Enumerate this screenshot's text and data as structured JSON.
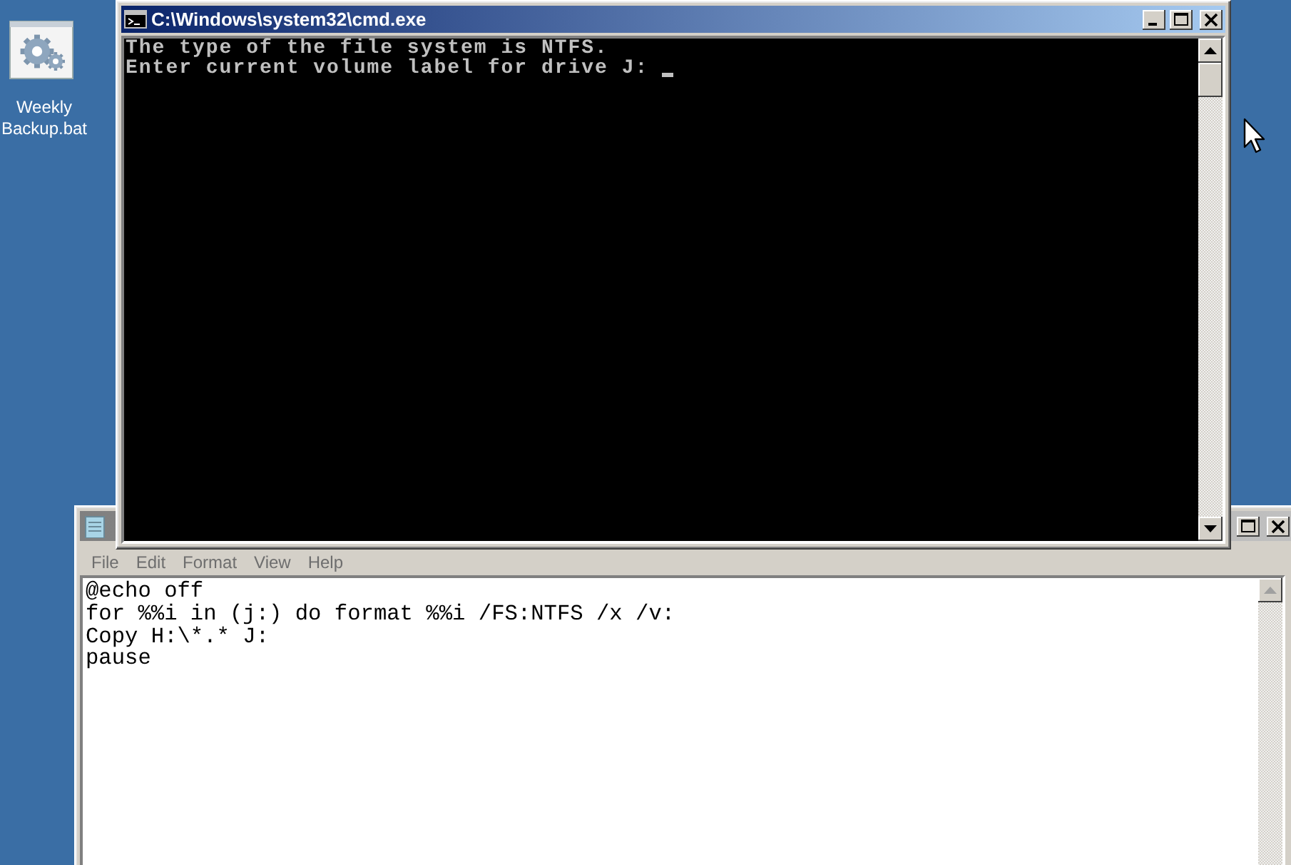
{
  "desktop_icons": [
    {
      "label": "Weekly Backup.bat"
    }
  ],
  "windows": [
    {
      "kind": "console",
      "active": true,
      "title": "C:\\Windows\\system32\\cmd.exe",
      "controls": [
        {
          "kind": "minimize"
        },
        {
          "kind": "maximize"
        },
        {
          "kind": "close"
        }
      ],
      "lines": [
        "The type of the file system is NTFS.",
        "Enter current volume label for drive J: "
      ]
    },
    {
      "kind": "notepad",
      "active": false,
      "controls": [
        {
          "kind": "maximize"
        },
        {
          "kind": "close"
        }
      ],
      "menu": [
        {
          "label": "File",
          "disabled": true
        },
        {
          "label": "Edit",
          "disabled": true
        },
        {
          "label": "Format",
          "disabled": true
        },
        {
          "label": "View",
          "disabled": true
        },
        {
          "label": "Help",
          "disabled": true
        }
      ],
      "lines": [
        "@echo off",
        "for %%i in (j:) do format %%i /FS:NTFS /x /v:",
        "Copy H:\\*.* J:",
        "pause"
      ]
    }
  ]
}
